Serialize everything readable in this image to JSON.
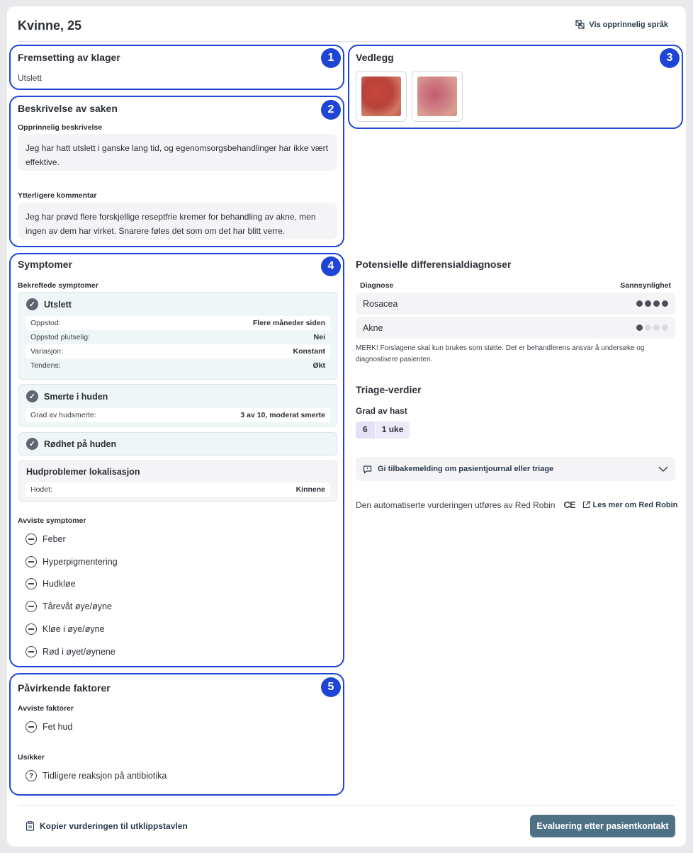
{
  "header": {
    "title": "Kvinne, 25",
    "lang_toggle": "Vis opprinnelig språk"
  },
  "complaint": {
    "badge": "1",
    "heading": "Fremsetting av klager",
    "value": "Utslett"
  },
  "description": {
    "badge": "2",
    "heading": "Beskrivelse av saken",
    "original_label": "Opprinnelig beskrivelse",
    "original_text": "Jeg har hatt utslett i ganske lang tid, og egenomsorgsbehandlinger har ikke vært effektive.",
    "additional_label": "Ytterligere kommentar",
    "additional_text": "Jeg har prøvd flere forskjellige reseptfrie kremer for behandling av akne, men ingen av dem har virket. Snarere føles det som om det har blitt verre."
  },
  "attachments": {
    "badge": "3",
    "heading": "Vedlegg"
  },
  "symptoms": {
    "badge": "4",
    "heading": "Symptomer",
    "confirmed_label": "Bekreftede symptomer",
    "confirmed": [
      {
        "name": "Utslett",
        "rows": [
          {
            "k": "Oppstod:",
            "v": "Flere måneder siden"
          },
          {
            "k": "Oppstod plutselig:",
            "v": "Nei"
          },
          {
            "k": "Variasjon:",
            "v": "Konstant"
          },
          {
            "k": "Tendens:",
            "v": "Økt"
          }
        ]
      },
      {
        "name": "Smerte i huden",
        "rows": [
          {
            "k": "Grad av hudsmerte:",
            "v": "3 av 10, moderat smerte"
          }
        ]
      },
      {
        "name": "Rødhet på huden",
        "rows": []
      }
    ],
    "location": {
      "name": "Hudproblemer lokalisasjon",
      "k": "Hodet:",
      "v": "Kinnene"
    },
    "rejected_label": "Avviste symptomer",
    "rejected": [
      "Feber",
      "Hyperpigmentering",
      "Hudkløe",
      "Tårevåt øye/øyne",
      "Kløe i øye/øyne",
      "Rød i øyet/øynene"
    ]
  },
  "factors": {
    "badge": "5",
    "heading": "Påvirkende faktorer",
    "rejected_label": "Avviste faktorer",
    "rejected": [
      "Fet hud"
    ],
    "uncertain_label": "Usikker",
    "uncertain": [
      "Tidligere reaksjon på antibiotika"
    ]
  },
  "differentials": {
    "heading": "Potensielle differensialdiagnoser",
    "col_diagnosis": "Diagnose",
    "col_probability": "Sannsynlighet",
    "items": [
      {
        "name": "Rosacea",
        "probability_level": 4,
        "max_level": 4
      },
      {
        "name": "Akne",
        "probability_level": 1,
        "max_level": 4
      }
    ],
    "note": "MERK! Forslagene skal kun brukes som støtte. Det er behandlerens ansvar å undersøke og diagnostisere pasienten."
  },
  "triage": {
    "heading": "Triage-verdier",
    "urgency_label": "Grad av hast",
    "urgency_level": "6",
    "urgency_time": "1 uke"
  },
  "feedback": {
    "label": "Gi tilbakemelding om pasientjournal eller triage"
  },
  "footer_note": {
    "text": "Den automatiserte vurderingen utføres av Red Robin",
    "ce": "CE",
    "link": "Les mer om Red Robin"
  },
  "actions": {
    "copy": "Kopier vurderingen til utklippstavlen",
    "evaluate": "Evaluering etter pasientkontakt"
  },
  "colors": {
    "accent": "#1f45d6",
    "button": "#4f7186"
  }
}
